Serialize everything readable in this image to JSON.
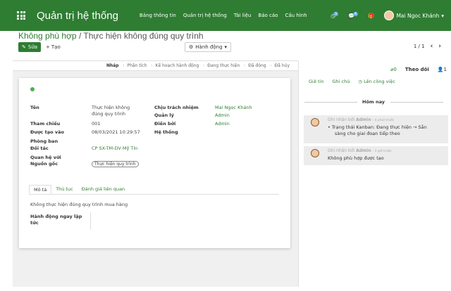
{
  "topbar": {
    "app_title": "Quản trị hệ thống",
    "menu": [
      "Bảng thông tin",
      "Quản trị hệ thống",
      "Tài liệu",
      "Báo cáo",
      "Cấu hình"
    ],
    "activity_count": "3",
    "message_count": "4",
    "user_name": "Mai Ngoc Khánh"
  },
  "control_panel": {
    "breadcrumb_parent": "Không phù hợp",
    "breadcrumb_sep": "/",
    "breadcrumb_current": "Thực hiện không đúng quy trình",
    "edit_label": "Sửa",
    "create_label": "Tạo",
    "action_label": "Hành động",
    "pager": "1 / 1"
  },
  "stages": [
    "Nháp",
    "Phân tích",
    "Kế hoạch hành động",
    "Đang thực hiện",
    "Đã đóng",
    "Đã hủy"
  ],
  "active_stage": "Nháp",
  "form": {
    "name_label": "Tên",
    "name_value_1": "Thực hiện không",
    "name_value_2": "đúng quy trình",
    "ref_label": "Tham chiếu",
    "ref_value": "001",
    "created_label": "Được tạo vào",
    "created_value": "08/03/2021 10:29:57",
    "dept_label": "Phòng ban",
    "partner_label": "Đối tác",
    "partner_value": "CP SX-TM-DV Mỹ Tín",
    "contact_label": "Quan hệ với",
    "source_label": "Nguồn gốc",
    "source_value": "Thực hiện quy trình",
    "resp_label": "Chịu trách nhiệm",
    "resp_value": "Mai Ngọc Khánh",
    "manager_label": "Quản lý",
    "manager_value": "Admin",
    "filled_label": "Điền bởi",
    "filled_value": "Admin",
    "system_label": "Hệ thống",
    "tabs": [
      "Mô tả",
      "Thủ tục",
      "Đánh giá liên quan"
    ],
    "description": "Không thực hiện đúng quy trình mua hàng",
    "immediate_label_1": "Hành động ngay lập",
    "immediate_label_2": "tức"
  },
  "chatter": {
    "followers_count": "0",
    "follow_label": "Theo dõi",
    "people_count": "1",
    "send_msg": "Gửi tin",
    "note": "Ghi chú",
    "schedule": "Lên công việc",
    "today": "Hôm nay",
    "messages": [
      {
        "author_prefix": "Ghi nhận bởi",
        "author": "Admin",
        "time": "- 4 phút trước",
        "line1": "Trạng thái Kanban: Đang thực hiện → Sẵn",
        "line2": "sàng cho giai đoạn tiếp theo"
      },
      {
        "author_prefix": "Ghi nhận bởi",
        "author": "Admin",
        "time": "- 3 giờ trước",
        "line1": "Không phù hợp được tạo"
      }
    ]
  }
}
